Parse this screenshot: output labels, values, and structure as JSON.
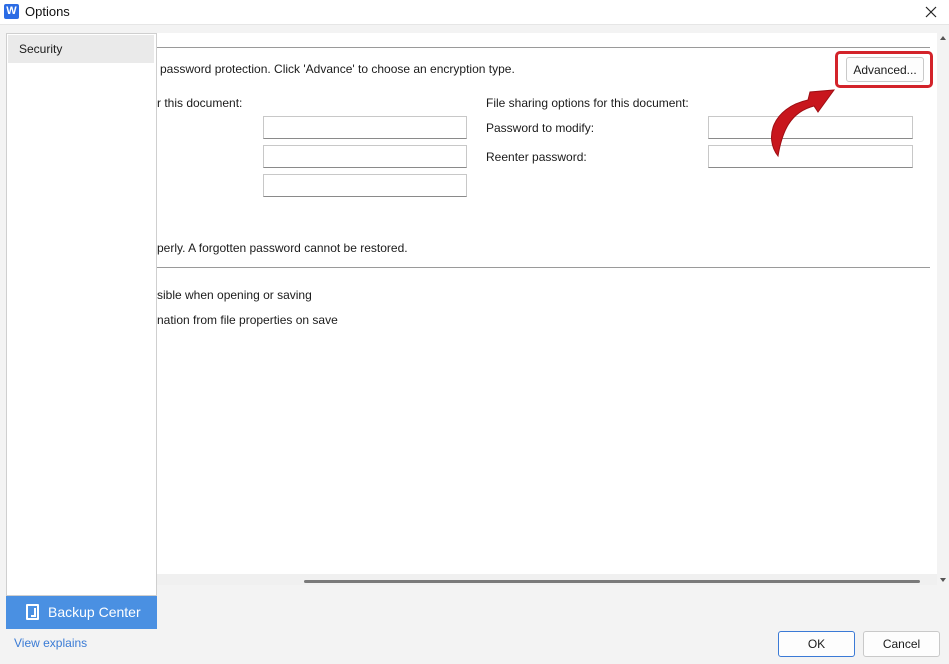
{
  "window": {
    "title": "Options",
    "logo_letter": "W"
  },
  "sidebar": {
    "items": [
      {
        "label": "Security"
      }
    ],
    "backup_label": "Backup Center",
    "view_explains": "View explains"
  },
  "main": {
    "encryption_text": "password protection. Click 'Advance' to choose an encryption type.",
    "advanced_button": "Advanced...",
    "open_section_label": "r this document:",
    "share_section_label": "File sharing options for this document:",
    "password_to_modify_label": "Password to modify:",
    "reenter_password_label": "Reenter password:",
    "warning_text": "perly. A forgotten password cannot be restored.",
    "option1_text": "sible when opening or saving",
    "option2_text": "nation from file properties on save"
  },
  "footer": {
    "ok_label": "OK",
    "cancel_label": "Cancel"
  },
  "colors": {
    "accent": "#4a90e2",
    "highlight": "#d3232a",
    "arrow": "#c8161d"
  }
}
